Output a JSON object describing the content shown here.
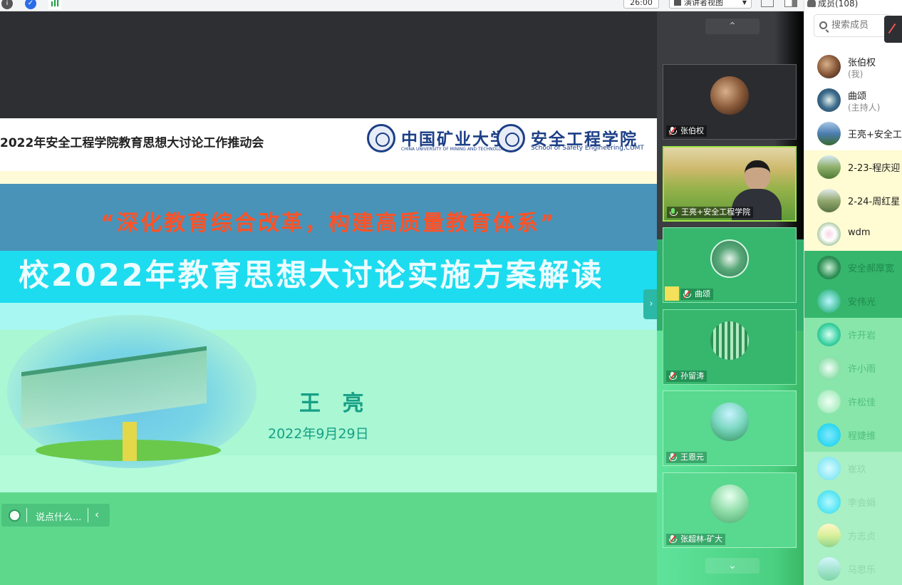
{
  "toolbar": {
    "timer": "26:00",
    "view_mode": "演讲者视图",
    "icons": [
      "info-icon",
      "shield-icon",
      "signal-bars-icon",
      "fullscreen-icon",
      "picture-in-picture-icon"
    ]
  },
  "slide": {
    "header_title": "2022年安全工程学院教育思想大讨论工作推动会",
    "logo1_cn": "中国矿业大学",
    "logo1_en": "CHINA UNIVERSITY OF MINING AND TECHNOLOGY",
    "logo2_cn": "安全工程学院",
    "logo2_en": "School of Safety Engineering,CUMT",
    "slogan": "“深化教育综合改革，构建高质量教育体系”",
    "main_title": "校2022年教育思想大讨论实施方案解读",
    "speaker": "王 亮",
    "date": "2022年9月29日",
    "colors": {
      "slogan": "#ff5226",
      "band": "#4a93b8",
      "cyan": "#1ddcef",
      "teal_text": "#16a085"
    }
  },
  "chat": {
    "placeholder": "说点什么..."
  },
  "videos": [
    {
      "name": "张伯权",
      "mic": "muted"
    },
    {
      "name": "王亮+安全工程学院",
      "mic": "on",
      "active": true
    },
    {
      "name": "曲颂",
      "mic": "muted",
      "host": true
    },
    {
      "name": "孙留涛",
      "mic": "muted"
    },
    {
      "name": "王恩元",
      "mic": "muted"
    },
    {
      "name": "张超林-矿大",
      "mic": "muted"
    }
  ],
  "members_panel": {
    "header": "成员(108)",
    "search_placeholder": "搜索成员",
    "members": [
      {
        "name": "张伯权",
        "role": "(我)"
      },
      {
        "name": "曲颂",
        "role": "(主持人)"
      },
      {
        "name": "王亮+安全工程",
        "role": ""
      },
      {
        "name": "2-23-程庆迎",
        "role": ""
      },
      {
        "name": "2-24-周红星",
        "role": ""
      },
      {
        "name": "wdm",
        "role": ""
      },
      {
        "name": "安全郝厚宽",
        "role": ""
      },
      {
        "name": "安伟光",
        "role": ""
      },
      {
        "name": "许开岩",
        "role": ""
      },
      {
        "name": "许小雨",
        "role": ""
      },
      {
        "name": "许松佳",
        "role": ""
      },
      {
        "name": "程婕维",
        "role": ""
      },
      {
        "name": "崔玖",
        "role": ""
      },
      {
        "name": "李会娟",
        "role": ""
      },
      {
        "name": "方志贞",
        "role": ""
      },
      {
        "name": "马思乐",
        "role": ""
      }
    ]
  }
}
